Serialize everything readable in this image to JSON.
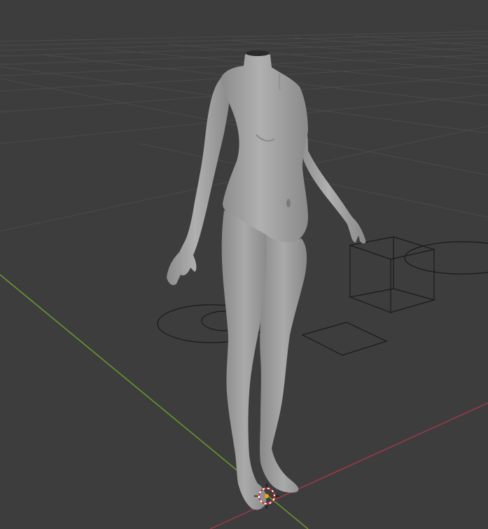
{
  "viewport": {
    "background_color": "#3d3d3d",
    "grid_color": "#4a4a4a",
    "y_axis_color": "#6a9a2e",
    "x_axis_color": "#9c3a48",
    "mesh_color": "#9a9a9a",
    "wire_color": "#1a1a1a"
  },
  "objects": [
    {
      "name": "body-mesh",
      "kind": "mesh",
      "shading": "solid"
    },
    {
      "name": "camera",
      "kind": "camera",
      "shape": "wire-square"
    },
    {
      "name": "light-cube",
      "kind": "empty",
      "shape": "wire-cube"
    },
    {
      "name": "light-circle-left",
      "kind": "light",
      "shape": "wire-circle"
    },
    {
      "name": "light-circle-right",
      "kind": "light",
      "shape": "wire-circle"
    }
  ],
  "cursor": {
    "icon": "3d-cursor-icon"
  }
}
